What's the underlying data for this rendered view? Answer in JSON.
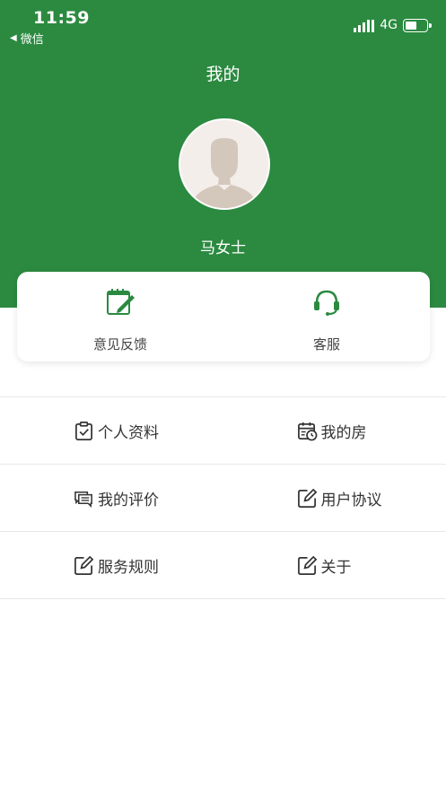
{
  "status_bar": {
    "time": "11:59",
    "back_app": "微信",
    "network": "4G",
    "battery_level": 0.55
  },
  "header": {
    "title": "我的",
    "username": "马女士"
  },
  "card": {
    "items": [
      {
        "label": "意见反馈",
        "icon": "feedback-notepad-icon"
      },
      {
        "label": "客服",
        "icon": "headset-icon"
      }
    ]
  },
  "menu": {
    "items": [
      {
        "label": "个人资料",
        "icon": "clipboard-check-icon"
      },
      {
        "label": "我的房",
        "icon": "calendar-clock-icon"
      },
      {
        "label": "我的评价",
        "icon": "chat-bubbles-icon"
      },
      {
        "label": "用户协议",
        "icon": "edit-icon"
      },
      {
        "label": "服务规则",
        "icon": "edit-icon"
      },
      {
        "label": "关于",
        "icon": "edit-icon"
      }
    ]
  },
  "colors": {
    "primary": "#2b8a40",
    "background": "#ffffff",
    "divider": "#e8e8e8",
    "text": "#333333"
  }
}
